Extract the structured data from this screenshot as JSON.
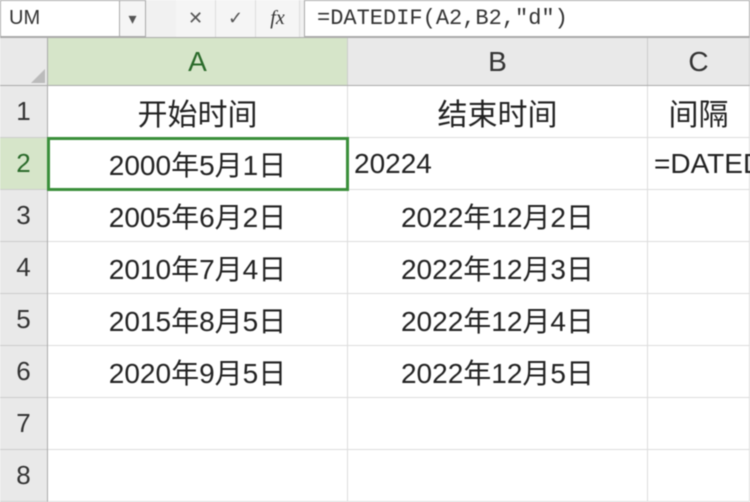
{
  "formula_bar": {
    "name_box": "UM",
    "cancel_title": "Cancel",
    "enter_title": "Enter",
    "fx_label": "fx",
    "formula_text": "=DATEDIF(A2,B2,\"d\")"
  },
  "columns": {
    "A": "A",
    "B": "B",
    "C": "C"
  },
  "row_labels": [
    "1",
    "2",
    "3",
    "4",
    "5",
    "6",
    "7",
    "8"
  ],
  "active": {
    "col": "A",
    "row": 2
  },
  "headers": {
    "A": "开始时间",
    "B": "结束时间",
    "C": "间隔"
  },
  "rows": [
    {
      "A": "2000年5月1日",
      "B": "20224",
      "C": ""
    },
    {
      "A": "2005年6月2日",
      "B": "2022年12月2日",
      "C": ""
    },
    {
      "A": "2010年7月4日",
      "B": "2022年12月3日",
      "C": ""
    },
    {
      "A": "2015年8月5日",
      "B": "2022年12月4日",
      "C": ""
    },
    {
      "A": "2020年9月5日",
      "B": "2022年12月5日",
      "C": ""
    }
  ],
  "c2_editing_overlay": "=DATEDIF(A"
}
